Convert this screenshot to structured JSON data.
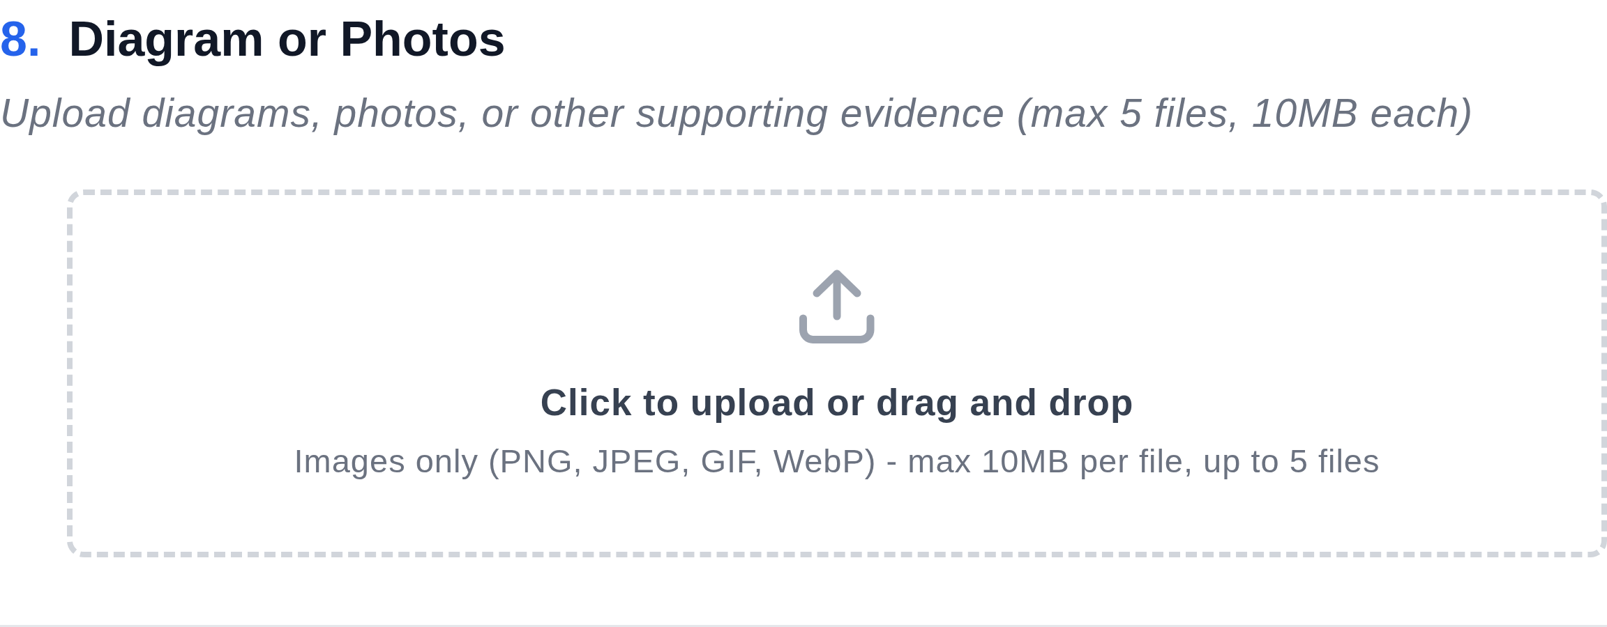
{
  "section": {
    "number": "8.",
    "title": "Diagram or Photos",
    "description": "Upload diagrams, photos, or other supporting evidence (max 5 files, 10MB each)"
  },
  "dropzone": {
    "prompt": "Click to upload or drag and drop",
    "hint": "Images only (PNG, JPEG, GIF, WebP) - max 10MB per file, up to 5 files"
  }
}
